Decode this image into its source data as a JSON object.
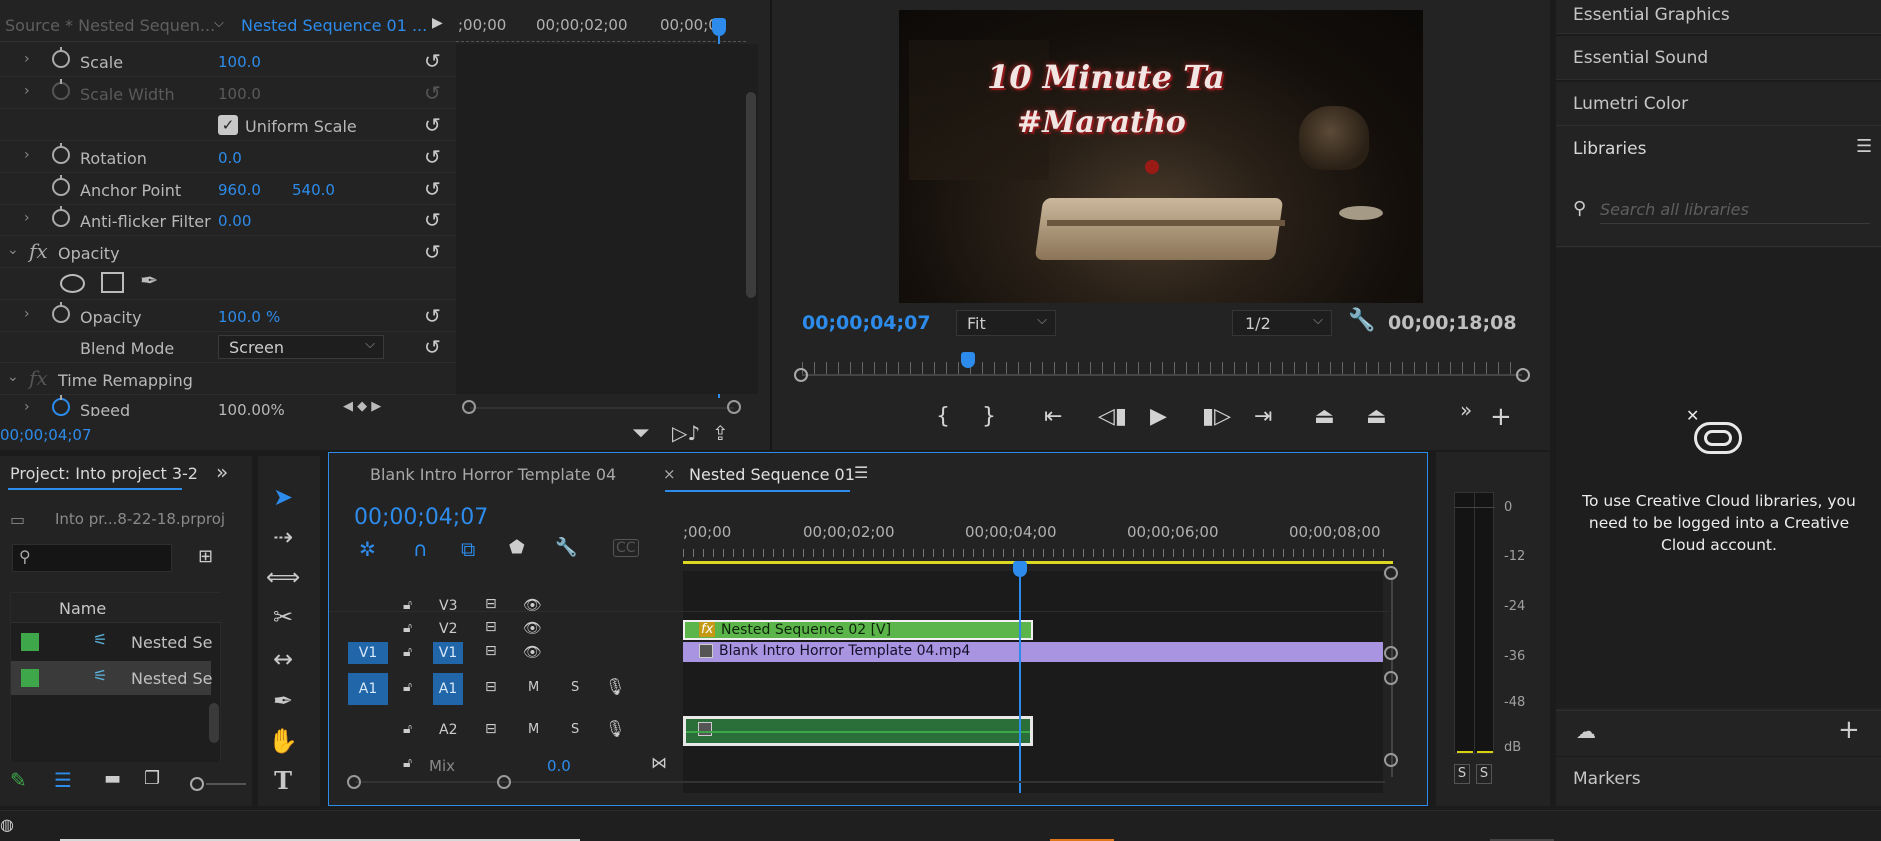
{
  "effect_controls": {
    "source_tab": "Source * Nested Sequen...",
    "sequence_tab": "Nested Sequence 01 ...",
    "ruler_marks": [
      ";00;00",
      "00;00;02;00",
      "00;00;0"
    ],
    "rows": {
      "scale": {
        "label": "Scale",
        "value": "100.0"
      },
      "scale_width": {
        "label": "Scale Width",
        "value": "100.0"
      },
      "uniform_scale": {
        "label": "Uniform Scale"
      },
      "rotation": {
        "label": "Rotation",
        "value": "0.0"
      },
      "anchor_point": {
        "label": "Anchor Point",
        "x": "960.0",
        "y": "540.0"
      },
      "anti_flicker": {
        "label": "Anti-flicker Filter",
        "value": "0.00"
      },
      "opacity_group": {
        "label": "Opacity"
      },
      "opacity": {
        "label": "Opacity",
        "value": "100.0",
        "unit": "%"
      },
      "blend_mode": {
        "label": "Blend Mode",
        "value": "Screen"
      },
      "time_remap": {
        "label": "Time Remapping"
      },
      "speed": {
        "label": "Speed",
        "value": "100.00%"
      }
    },
    "timecode": "00;00;04;07",
    "fx_label": "fx"
  },
  "program_monitor": {
    "title_line1": "10 Minute Ta",
    "title_line2": "#Maratho",
    "timecode": "00;00;04;07",
    "zoom": "Fit",
    "resolution": "1/2",
    "duration": "00;00;18;08",
    "playhead_fraction": 0.23
  },
  "project": {
    "title": "Project: Into project 3-2",
    "file": "Into pr...8-22-18.prproj",
    "col_name": "Name",
    "items": [
      {
        "name": "Nested Se",
        "color": "#3ea74a"
      },
      {
        "name": "Nested Se",
        "color": "#3ea74a"
      }
    ]
  },
  "timeline": {
    "tab1": "Blank Intro Horror Template 04",
    "tab2": "Nested Sequence 01",
    "timecode": "00;00;04;07",
    "ruler": [
      ";00;00",
      "00;00;02;00",
      "00;00;04;00",
      "00;00;06;00",
      "00;00;08;00"
    ],
    "tracks": {
      "v3": "V3",
      "v2": "V2",
      "v1": "V1",
      "v1_src": "V1",
      "a1": "A1",
      "a1_src": "A1",
      "a2": "A2",
      "mix": "Mix",
      "mix_val": "0.0",
      "m": "M",
      "s": "S"
    },
    "clips": {
      "nested": "Nested Sequence 02 [V]",
      "blank": "Blank Intro Horror Template 04.mp4"
    }
  },
  "meter": {
    "labels": [
      "0",
      "-12",
      "-24",
      "-36",
      "-48",
      "dB"
    ],
    "solo": "S"
  },
  "libraries": {
    "panels": [
      "Essential Graphics",
      "Essential Sound",
      "Lumetri Color"
    ],
    "title": "Libraries",
    "search_placeholder": "Search all libraries",
    "message": "To use Creative Cloud libraries, you need to be logged into a Creative Cloud account.",
    "markers": "Markers"
  },
  "colors": {
    "accent": "#2d8ceb",
    "clip_green": "#5bb54a",
    "clip_purple": "#a894e0",
    "audio_green": "#2a6e3a"
  }
}
